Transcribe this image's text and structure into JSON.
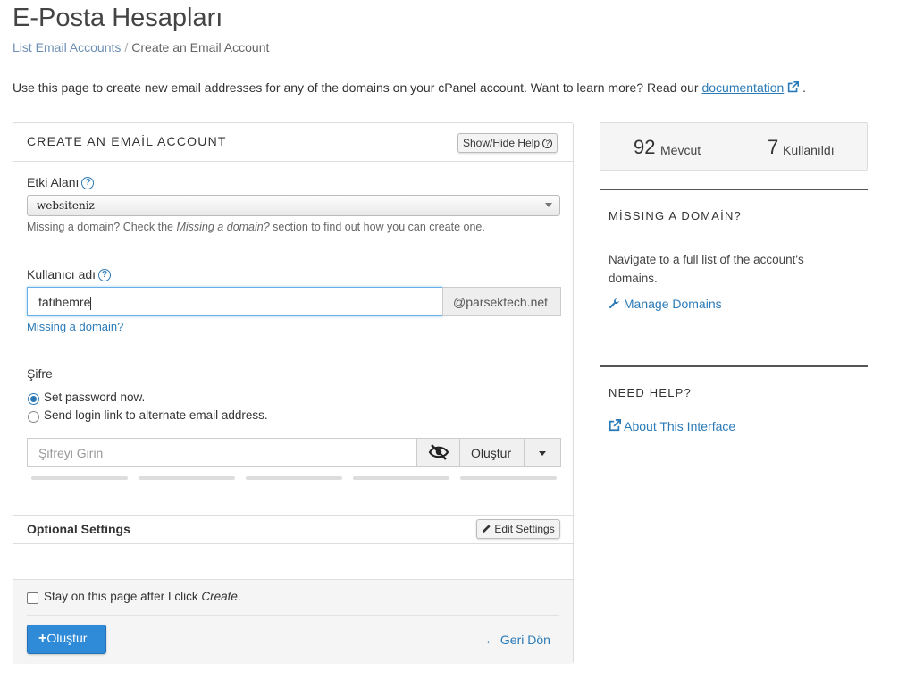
{
  "page": {
    "title": "E-Posta Hesapları",
    "breadcrumb": {
      "parent": "List Email Accounts",
      "separator": "/",
      "current": "Create an Email Account"
    },
    "intro_text": "Use this page to create new email addresses for any of the domains on your cPanel account. Want to learn more? Read our",
    "intro_link": "documentation",
    "intro_end": "."
  },
  "form": {
    "card_title": "CREATE AN EMAİL ACCOUNT",
    "help_button": "Show/Hide Help",
    "domain_label": "Etki Alanı",
    "domain_value": "websiteniz",
    "domain_hint_before": "Missing a domain? Check the",
    "domain_hint_em": "Missing a domain?",
    "domain_hint_after": "section to find out how you can create one.",
    "username_label": "Kullanıcı adı",
    "username_value": "fatihemre",
    "domain_suffix": "@parsektech.net",
    "missing_domain_link": "Missing a domain?",
    "password_label": "Şifre",
    "radio_set_now": "Set password now.",
    "radio_send_link": "Send login link to alternate email address.",
    "radio_selected": "set_now",
    "password_placeholder": "Şifreyi Girin",
    "generate_button": "Oluştur",
    "optional_title": "Optional Settings",
    "edit_settings_button": "Edit Settings",
    "stay_text_before": "Stay on this page after I click",
    "stay_text_em": "Create",
    "stay_text_after": ".",
    "create_button": "Oluştur",
    "back_link": "Geri Dön"
  },
  "stats": {
    "available_count": "92",
    "available_label": "Mevcut",
    "used_count": "7",
    "used_label": "Kullanıldı"
  },
  "sidebar": {
    "missing_title": "MİSSING A DOMAİN?",
    "missing_text": "Navigate to a full list of the account's domains.",
    "manage_link": "Manage Domains",
    "help_title": "NEED HELP?",
    "about_link": "About This Interface"
  },
  "colors": {
    "link": "#2a7ab8",
    "primary": "#2f8bd8",
    "focus": "#66afe9"
  }
}
